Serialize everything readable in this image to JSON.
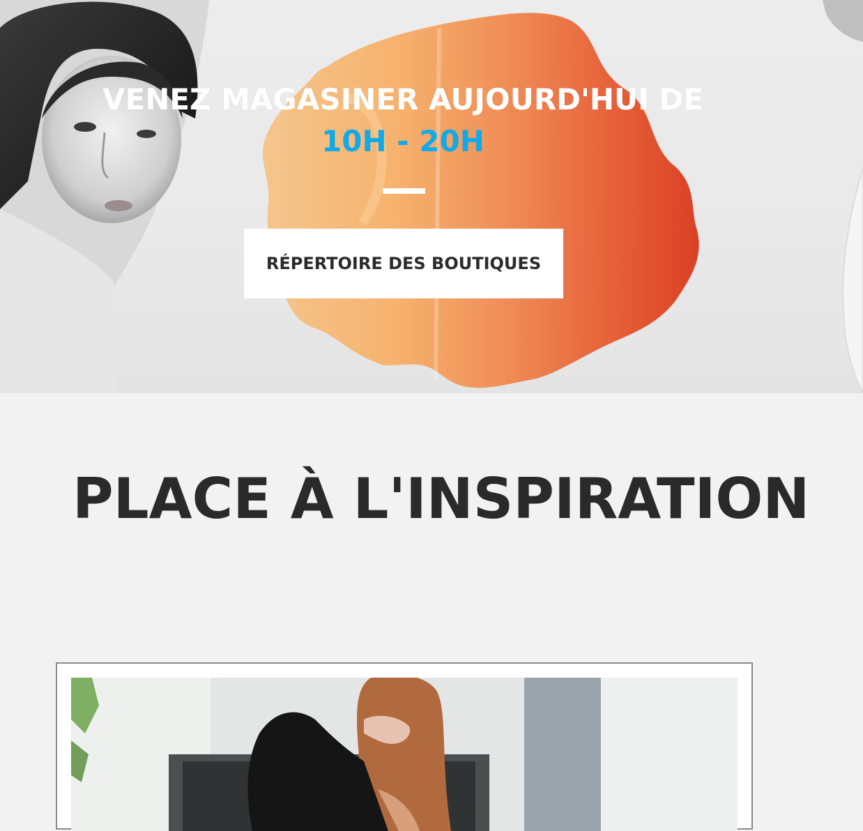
{
  "hero": {
    "headline": "VENEZ MAGASINER AUJOURD'HUI DE",
    "hours": "10H - 20H",
    "hours_color": "#12a9e8",
    "button_label": "RÉPERTOIRE DES BOUTIQUES"
  },
  "inspiration": {
    "title": "PLACE À L'INSPIRATION"
  },
  "colors": {
    "page_background": "#f2f2f2",
    "watercolor_orange": "#f08a4b",
    "watercolor_red": "#de3e1d"
  }
}
